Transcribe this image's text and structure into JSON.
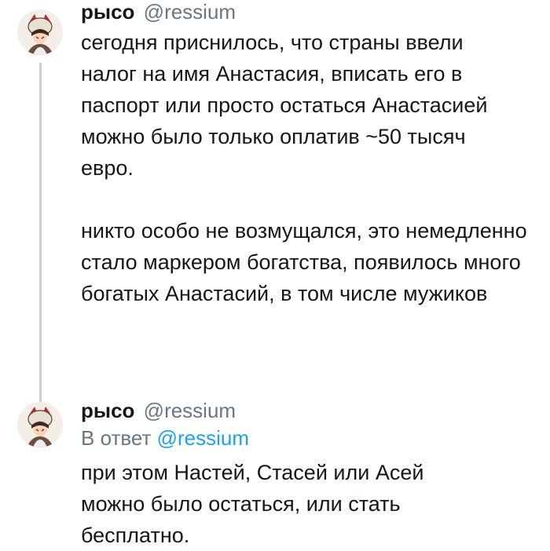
{
  "tweets": [
    {
      "display_name": "рысо",
      "handle": "@ressium",
      "paragraphs": [
        "сегодня приснилось, что страны ввели налог на имя Анастасия, вписать его в паспорт или просто остаться Анастасией можно было только оплатив ~50 тысяч евро.",
        "никто особо не возмущался, это немедленно стало маркером богатства, появилось много богатых Анастасий, в том числе мужиков"
      ]
    },
    {
      "display_name": "рысо",
      "handle": "@ressium",
      "reply_prefix": "В ответ",
      "reply_handle": "@ressium",
      "paragraphs": [
        "при этом Настей, Стасей или Асей можно было остаться, или стать бесплатно."
      ]
    }
  ],
  "colors": {
    "text": "#14171a",
    "secondary": "#657786",
    "link": "#1da1f2",
    "thread_line": "#c9d2da"
  },
  "icons": {
    "avatar": "avatar-image"
  }
}
